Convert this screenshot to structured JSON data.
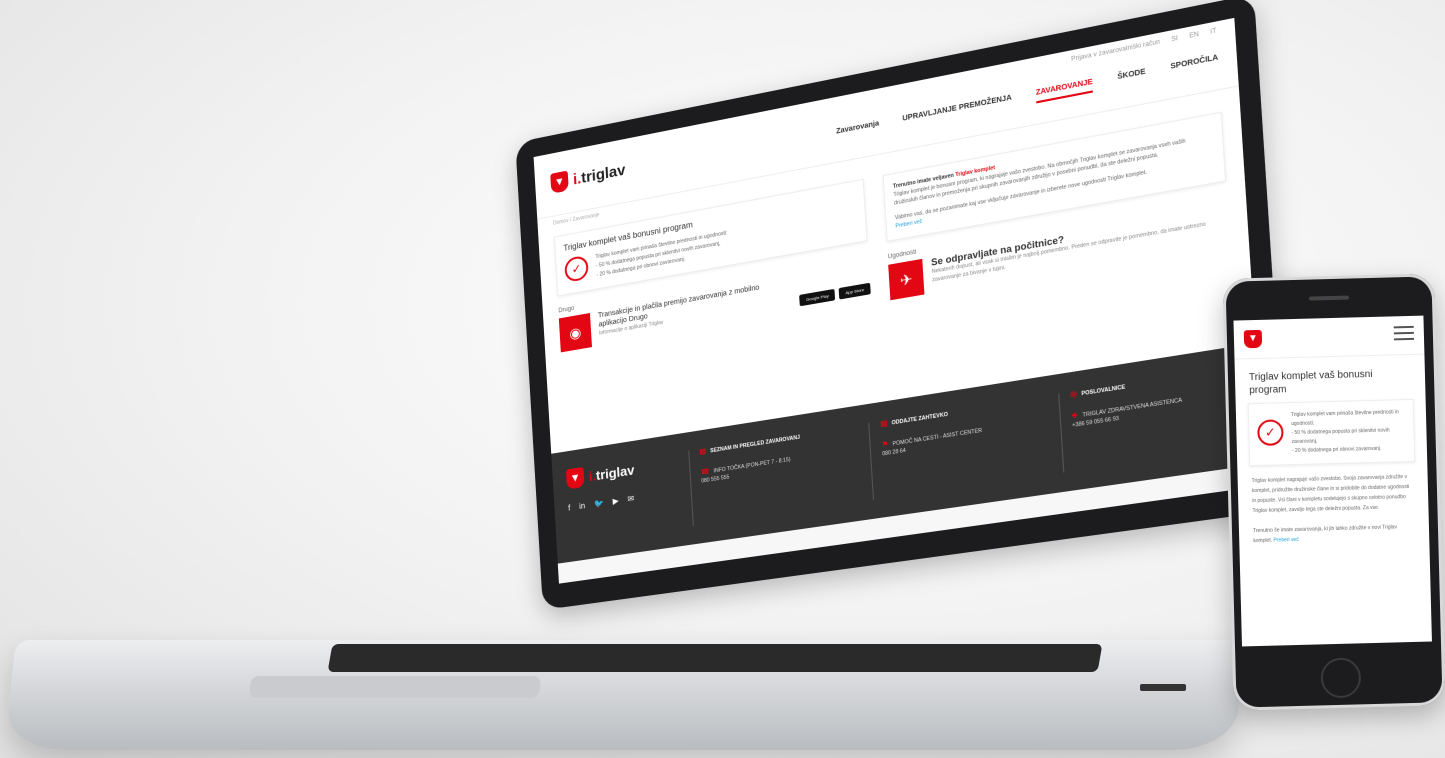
{
  "brand": {
    "logo_text": "triglav",
    "logo_prefix": "i.",
    "accent_color": "#e30613",
    "footer_bg": "#333333"
  },
  "header": {
    "utility": [
      "Prijava v zavarovalniški račun",
      "SI",
      "EN",
      "IT"
    ],
    "nav": [
      "Zavarovanja",
      "UPRAVLJANJE PREMOŽENJA",
      "ZAVAROVANJE",
      "ŠKODE",
      "SPOROČILA"
    ],
    "active_index": 2,
    "breadcrumb": "Domov / Zavarovanje"
  },
  "left_card": {
    "title": "Triglav komplet vaš bonusni program",
    "intro": "Triglav komplet vam prinaša številne prednosti in ugodnosti:",
    "bullets": [
      "- 50 % dodatnega popusta pri sklenitvi novih zavarovanj,",
      "- 20 % dodatnega pri obnovi zavarovanj."
    ]
  },
  "right_text": {
    "lead": "Trenutno imate veljaven",
    "lead_red": "Triglav komplet",
    "body": "Triglav komplet je bonusni program, ki nagrajuje vašo zvestobo. Na območjih Triglav komplet se zavarovanja vseh vaših družinskih članov in premoženja pri skupnih zavarovanjih združijo v posebni ponudbi, da ste deležni popusta.",
    "body2": "Vabimo vas, da se pozanimate kaj vse vključuje zavarovanje in izberete nove ugodnosti Triglav komplet.",
    "link": "Preberi več"
  },
  "drugi": {
    "label": "Drugo",
    "title": "Transakcije in plačila premijo zavarovanja z mobilno aplikacijo Drugo",
    "link": "Informacije o aplikaciji Triglav",
    "stores": [
      "Google Play",
      "App Store"
    ]
  },
  "ugodnosti": {
    "label": "Ugodnosti",
    "title": "Se odpravljate na počitnice?",
    "body": "Nekaterih dopust, ali vsak si mislim je najbolj pomembno. Preden se odpravite je pomembno, da imate ustrezno zavarovanje za bivanje v tujini."
  },
  "footer": {
    "logo_prefix": "i.",
    "logo_text": "triglav",
    "socials": [
      "f",
      "in",
      "tw",
      "yt",
      "mail"
    ],
    "cols": [
      {
        "title": "SEZNAM IN PREGLED ZAVAROVANJ",
        "line1": "INFO TOČKA (PON-PET 7 - 8:15)",
        "line2": "080 555 555"
      },
      {
        "title": "ODDAJTE ZAHTEVKO",
        "line1": "POMOČ NA CESTI - ASIST CENTER",
        "line2": "080 28 64"
      },
      {
        "title": "POSLOVALNICE",
        "line1": "TRIGLAV ZDRAVSTVENA ASISTENCA",
        "line2": "+386 59 055 66 93"
      }
    ]
  },
  "phone": {
    "title": "Triglav komplet vaš bonusni program",
    "intro": "Triglav komplet vam prinaša številne prednosti in ugodnosti:",
    "bullets": [
      "- 50 % dodatnega popusta pri sklenitvi novih zavarovanj,",
      "- 20 % dodatnega pri obnovi zavarovanj."
    ],
    "body": "Triglav komplet nagrajuje vašo zvestobo. Svoja zavarovanja združite v komplet, pridružite družinske člane in si pridobite do dodatne ugodnosti in popuste. Vsi člani v kompletu sodelujejo s skupno celotno ponudbo Triglav komplet, zavoljo tega ste deležni popusta. Za vse.",
    "body2": "Trenutno še imate zavarovanja, ki jih lahko združite v novi Triglav komplet.",
    "link": "Preberi več"
  }
}
